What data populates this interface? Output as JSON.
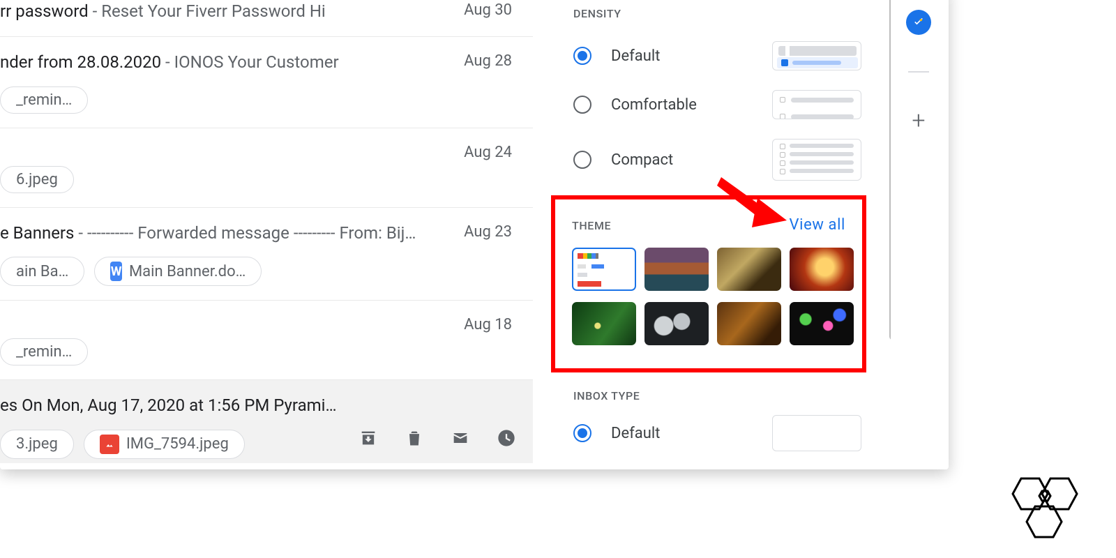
{
  "emails": [
    {
      "subject": "rr password",
      "body": " - Reset Your Fiverr Password Hi",
      "date": "Aug 30",
      "chips": []
    },
    {
      "subject": "nder from 28.08.2020",
      "body": " - IONOS Your Customer",
      "date": "Aug 28",
      "chips": [
        "_remin…"
      ]
    },
    {
      "subject": "",
      "body": "",
      "date": "Aug 24",
      "chips": [
        "6.jpeg"
      ]
    },
    {
      "subject": "e Banners",
      "body": " - ---------- Forwarded message --------- From: Bij…",
      "date": "Aug 23",
      "chips": [
        "ain Ba…",
        "Main Banner.do…"
      ]
    },
    {
      "subject": "",
      "body": "",
      "date": "Aug 18",
      "chips": [
        "_remin…"
      ]
    },
    {
      "subject": "",
      "body": "es On Mon, Aug 17, 2020 at 1:56 PM Pyrami…",
      "date": "",
      "chips": [
        "3.jpeg",
        "IMG_7594.jpeg"
      ],
      "hover": true
    }
  ],
  "settings": {
    "density_header": "DENSITY",
    "density": [
      {
        "label": "Default",
        "selected": true
      },
      {
        "label": "Comfortable",
        "selected": false
      },
      {
        "label": "Compact",
        "selected": false
      }
    ],
    "theme_header": "THEME",
    "view_all": "View all",
    "inbox_header": "INBOX TYPE",
    "inbox_default": "Default"
  }
}
